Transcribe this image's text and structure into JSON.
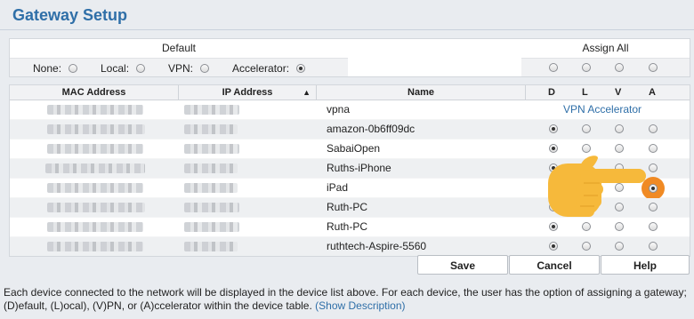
{
  "page": {
    "title": "Gateway Setup"
  },
  "defaults": {
    "header": "Default",
    "assign_header": "Assign All",
    "options": [
      {
        "label": "None:",
        "selected": false
      },
      {
        "label": "Local:",
        "selected": false
      },
      {
        "label": "VPN:",
        "selected": false
      },
      {
        "label": "Accelerator:",
        "selected": true
      }
    ]
  },
  "table": {
    "columns": {
      "mac": "MAC Address",
      "ip": "IP Address",
      "sort_indicator": "▲",
      "name": "Name",
      "d": "D",
      "l": "L",
      "v": "V",
      "a": "A"
    },
    "rows": [
      {
        "name": "vpna",
        "note": "VPN Accelerator",
        "selected": null
      },
      {
        "name": "amazon-0b6ff09dc",
        "selected": "D"
      },
      {
        "name": "SabaiOpen",
        "selected": "D"
      },
      {
        "name": "Ruths-iPhone",
        "selected": "D"
      },
      {
        "name": "iPad",
        "selected": "A"
      },
      {
        "name": "Ruth-PC",
        "selected": "D"
      },
      {
        "name": "Ruth-PC",
        "selected": "D"
      },
      {
        "name": "ruthtech-Aspire-5560",
        "selected": "D"
      }
    ]
  },
  "buttons": {
    "save": "Save",
    "cancel": "Cancel",
    "help": "Help"
  },
  "description": {
    "text": "Each device connected to the network will be displayed in the device list above. For each device, the user has the option of assigning a gateway; (D)efault, (L)ocal), (V)PN, or (A)ccelerator within the device table.",
    "link": "(Show Description)"
  },
  "colors": {
    "title": "#2f6fa8",
    "link": "#2f6fa8",
    "hand": "#f6b93b",
    "highlight": "#f08a24"
  },
  "icons": {
    "pointer": "pointing-hand-icon"
  }
}
